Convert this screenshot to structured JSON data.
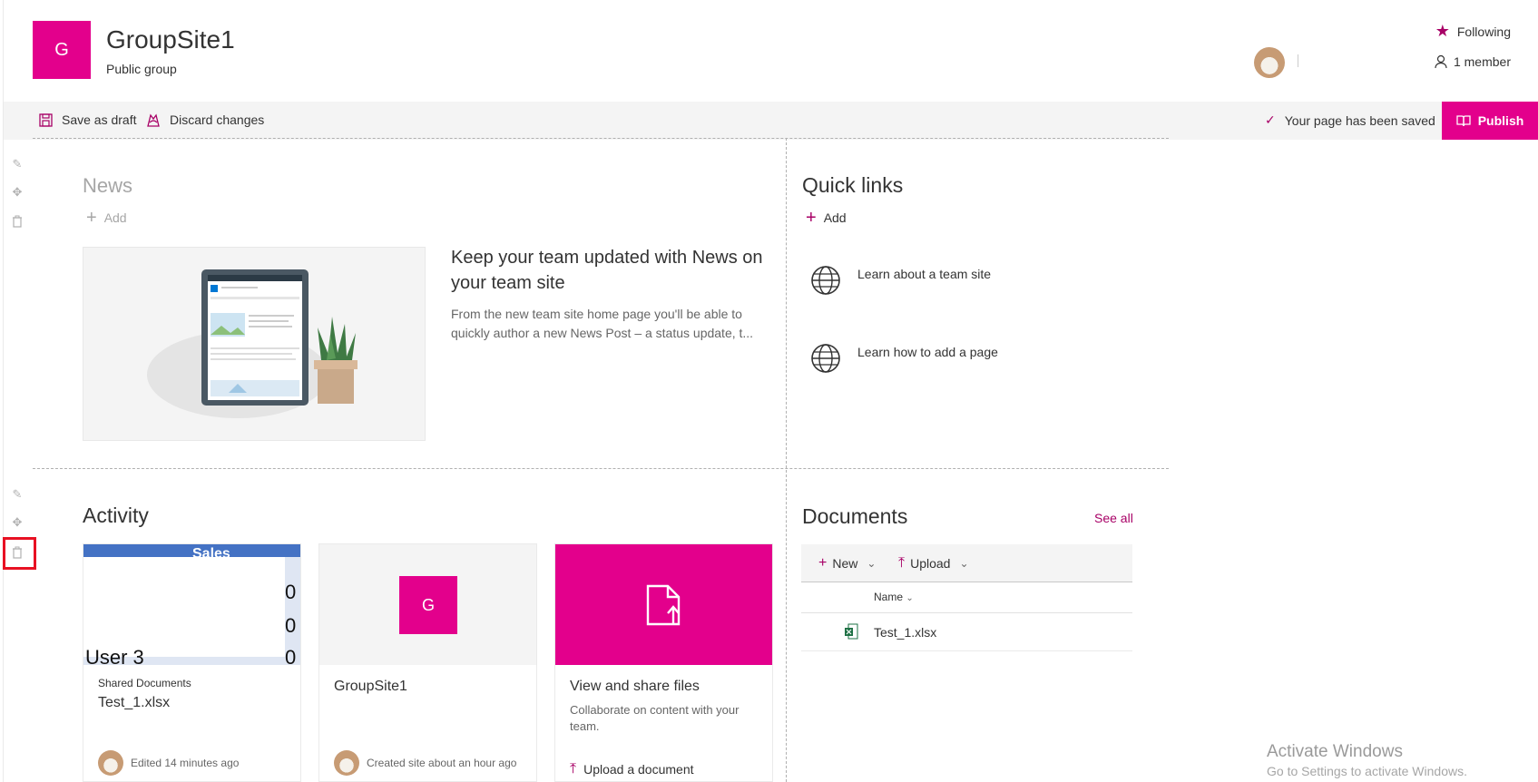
{
  "header": {
    "logo_letter": "G",
    "site_title": "GroupSite1",
    "site_subtitle": "Public group",
    "following_label": "Following",
    "member_label": "1 member"
  },
  "commandbar": {
    "save_draft": "Save as draft",
    "discard": "Discard changes",
    "saved_status": "Your page has been saved",
    "publish": "Publish"
  },
  "news": {
    "title": "News",
    "add_label": "Add",
    "headline": "Keep your team updated with News on your team site",
    "description": "From the new team site home page you'll be able to quickly author a new News Post – a status update, t..."
  },
  "quick_links": {
    "title": "Quick links",
    "add_label": "Add",
    "items": [
      {
        "label": "Learn about a team site",
        "icon": "globe-icon"
      },
      {
        "label": "Learn how to add a page",
        "icon": "globe-icon"
      }
    ]
  },
  "activity": {
    "title": "Activity",
    "cards": [
      {
        "small": "Shared Documents",
        "title": "Test_1.xlsx",
        "footer": "Edited 14 minutes ago",
        "preview_text": [
          "Sales",
          "0",
          "0",
          "User 3",
          "0"
        ]
      },
      {
        "logo_letter": "G",
        "title": "GroupSite1",
        "footer": "Created site about an hour ago"
      },
      {
        "title": "View and share files",
        "description": "Collaborate on content with your team.",
        "action": "Upload a document"
      }
    ]
  },
  "documents": {
    "title": "Documents",
    "see_all": "See all",
    "new_label": "New",
    "upload_label": "Upload",
    "column_name": "Name",
    "files": [
      {
        "name": "Test_1.xlsx",
        "icon": "excel-file-icon"
      }
    ]
  },
  "watermark": {
    "line1": "Activate Windows",
    "line2": "Go to Settings to activate Windows."
  },
  "colors": {
    "accent": "#e3008c",
    "accent_dark": "#a80066",
    "bar_bg": "#f4f4f4"
  }
}
